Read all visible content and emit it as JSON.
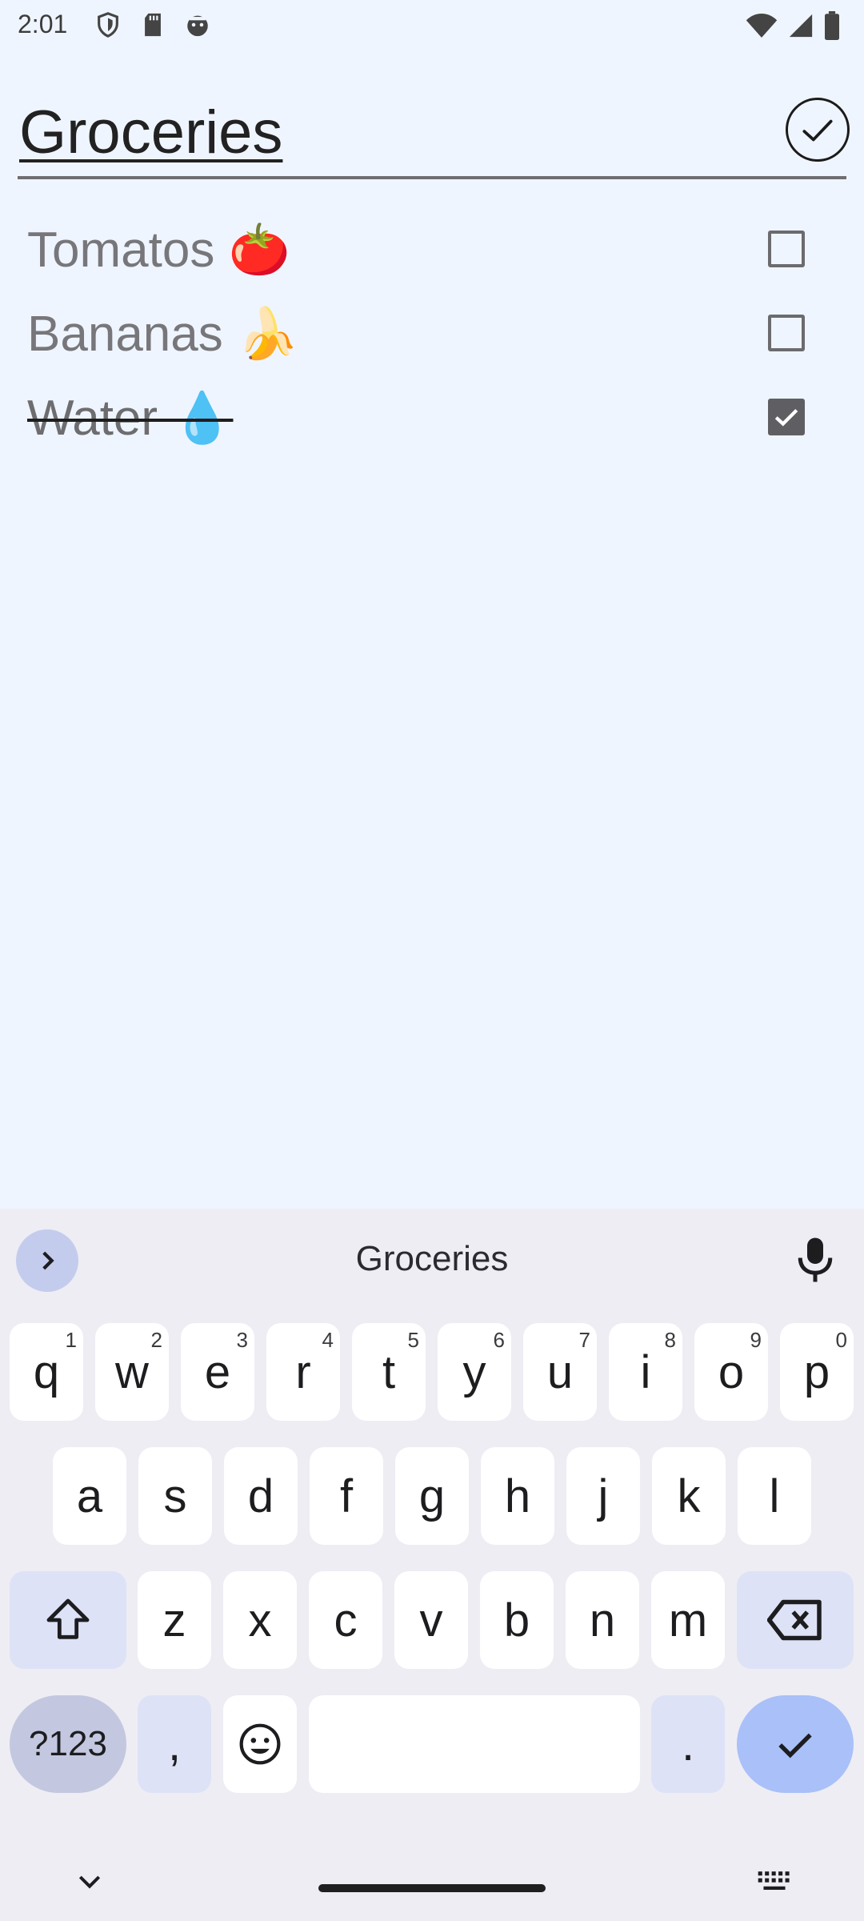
{
  "status_bar": {
    "time": "2:01",
    "left_icons": [
      "shield-icon",
      "sd-card-icon",
      "android-face-icon"
    ],
    "right_icons": [
      "wifi-icon",
      "signal-icon",
      "battery-icon"
    ]
  },
  "list": {
    "title": "Groceries",
    "done_icon": "check-circle-icon",
    "items": [
      {
        "label": "Tomatos 🍅",
        "checked": false
      },
      {
        "label": "Bananas 🍌",
        "checked": false
      },
      {
        "label": "Water 💧",
        "checked": true
      }
    ]
  },
  "keyboard": {
    "suggestion": "Groceries",
    "row1": [
      {
        "k": "q",
        "h": "1"
      },
      {
        "k": "w",
        "h": "2"
      },
      {
        "k": "e",
        "h": "3"
      },
      {
        "k": "r",
        "h": "4"
      },
      {
        "k": "t",
        "h": "5"
      },
      {
        "k": "y",
        "h": "6"
      },
      {
        "k": "u",
        "h": "7"
      },
      {
        "k": "i",
        "h": "8"
      },
      {
        "k": "o",
        "h": "9"
      },
      {
        "k": "p",
        "h": "0"
      }
    ],
    "row2": [
      "a",
      "s",
      "d",
      "f",
      "g",
      "h",
      "j",
      "k",
      "l"
    ],
    "row3": [
      "z",
      "x",
      "c",
      "v",
      "b",
      "n",
      "m"
    ],
    "symbols_label": "?123",
    "comma_label": ",",
    "period_label": "."
  },
  "colors": {
    "background": "#eff5fe",
    "keyboard_bg": "#eeedf4",
    "enter_key": "#a9c0f8"
  }
}
